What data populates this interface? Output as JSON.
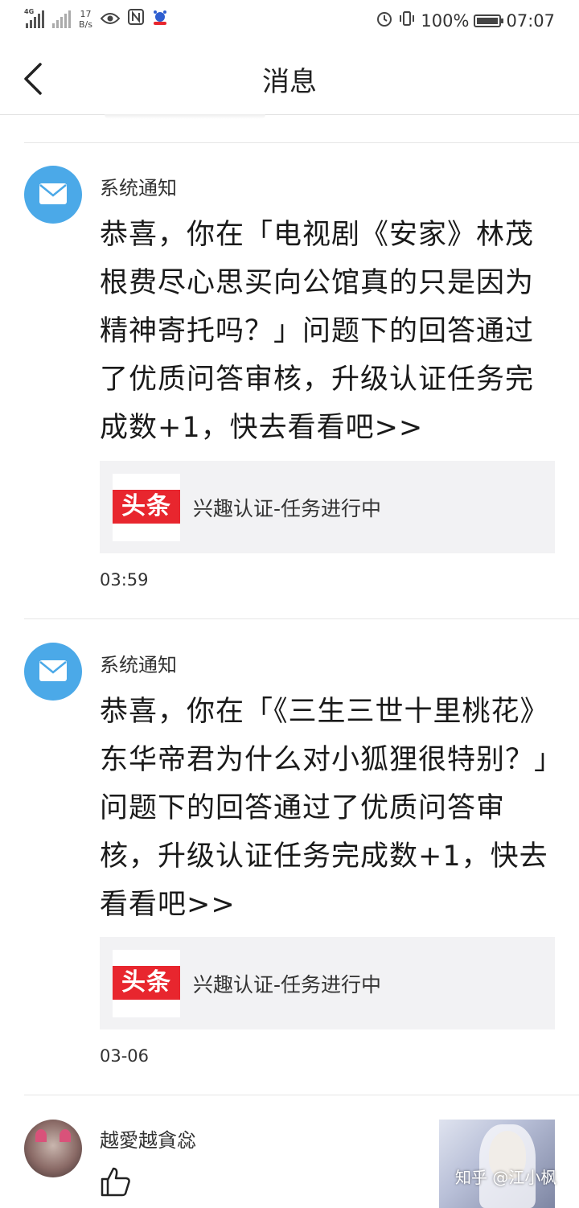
{
  "status_bar": {
    "network_tag": "4G",
    "speed_value": "17",
    "speed_unit": "B/s",
    "battery": "100%",
    "time": "07:07"
  },
  "header": {
    "title": "消息"
  },
  "messages": [
    {
      "sender": "系统通知",
      "body": "恭喜，你在「电视剧《安家》林茂根费尽心思买向公馆真的只是因为精神寄托吗？」问题下的回答通过了优质问答审核，升级认证任务完成数+1，快去看看吧>>",
      "card_logo": "头条",
      "card_text": "兴趣认证-任务进行中",
      "time": "03:59"
    },
    {
      "sender": "系统通知",
      "body": "恭喜，你在「《三生三世十里桃花》东华帝君为什么对小狐狸很特别？」问题下的回答通过了优质问答审核，升级认证任务完成数+1，快去看看吧>>",
      "card_logo": "头条",
      "card_text": "兴趣认证-任务进行中",
      "time": "03-06"
    }
  ],
  "user_item": {
    "name": "越愛越貪惢"
  },
  "watermark": "知乎 @江小枫",
  "colors": {
    "mail_avatar": "#4ba9e8",
    "logo_red": "#e8262e",
    "card_bg": "#f2f2f4"
  }
}
